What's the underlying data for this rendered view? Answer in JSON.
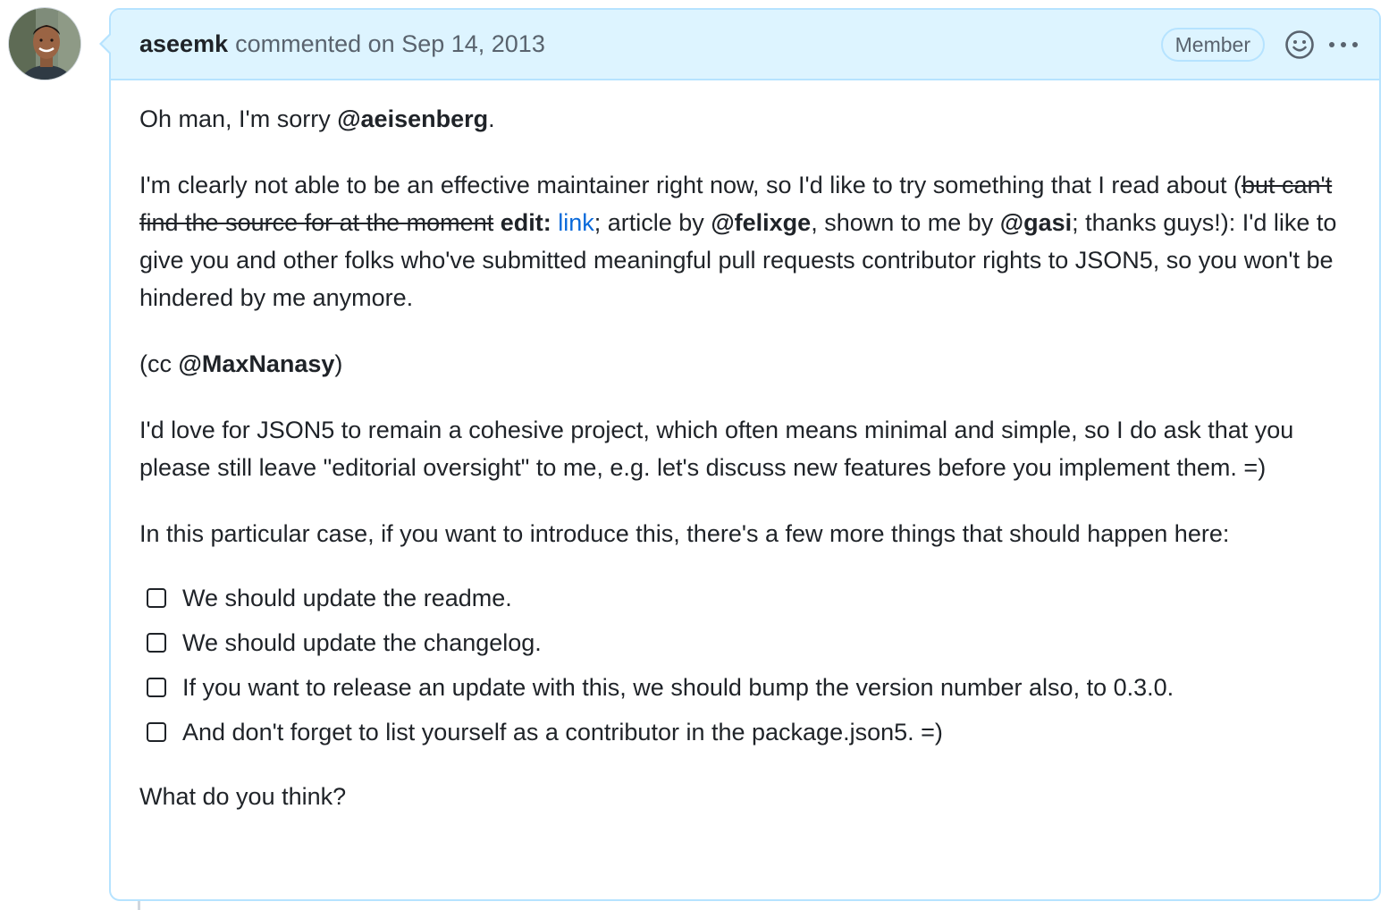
{
  "comment": {
    "author": "aseemk",
    "header_text": "commented on Sep 14, 2013",
    "role_badge": "Member",
    "icons": {
      "reaction": "smiley-icon",
      "more": "kebab-horizontal-icon"
    },
    "colors": {
      "header_bg": "#ddf4ff",
      "border": "#b6e3ff",
      "link": "#0969da"
    }
  },
  "body": {
    "p1": {
      "text": "Oh man, I'm sorry ",
      "mention": "@aeisenberg",
      "end": "."
    },
    "p2": {
      "t1": "I'm clearly not able to be an effective maintainer right now, so I'd like to try something that I read about (",
      "strikethrough": "but can't find the source for at the moment",
      "edit_label": "edit:",
      "link_text": "link",
      "t2": "; article by ",
      "mention1": "@felixge",
      "t3": ", shown to me by ",
      "mention2": "@gasi",
      "t4": "; thanks guys!): I'd like to give you and other folks who've submitted meaningful pull requests contributor rights to JSON5, so you won't be hindered by me anymore."
    },
    "p3": {
      "t1": "(cc ",
      "mention": "@MaxNanasy",
      "t2": ")"
    },
    "p4": "I'd love for JSON5 to remain a cohesive project, which often means minimal and simple, so I do ask that you please still leave \"editorial oversight\" to me, e.g. let's discuss new features before you implement them. =)",
    "p5": "In this particular case, if you want to introduce this, there's a few more things that should happen here:",
    "tasks": [
      {
        "label": "We should update the readme.",
        "checked": false
      },
      {
        "label": "We should update the changelog.",
        "checked": false
      },
      {
        "label": "If you want to release an update with this, we should bump the version number also, to 0.3.0.",
        "checked": false
      },
      {
        "label": "And don't forget to list yourself as a contributor in the package.json5. =)",
        "checked": false
      }
    ],
    "p6": "What do you think?"
  }
}
